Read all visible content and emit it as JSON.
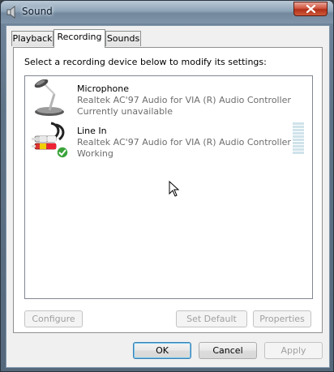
{
  "window": {
    "title": "Sound",
    "title_icon": "speaker-icon",
    "close_icon": "close-icon"
  },
  "tabs": [
    {
      "label": "Playback",
      "active": false
    },
    {
      "label": "Recording",
      "active": true
    },
    {
      "label": "Sounds",
      "active": false
    }
  ],
  "panel": {
    "instruction": "Select a recording device below to modify its settings:",
    "devices": [
      {
        "name": "Microphone",
        "description": "Realtek AC'97 Audio for VIA (R) Audio Controller",
        "status": "Currently unavailable",
        "icon": "microphone-icon"
      },
      {
        "name": "Line In",
        "description": "Realtek AC'97 Audio for VIA (R) Audio Controller",
        "status": "Working",
        "icon": "line-in-cable-icon",
        "badge_icon": "check-icon",
        "level_meter": "level-meter"
      }
    ],
    "buttons": {
      "configure": "Configure",
      "set_default": "Set Default",
      "properties": "Properties"
    }
  },
  "footer": {
    "ok": "OK",
    "cancel": "Cancel",
    "apply": "Apply"
  },
  "colors": {
    "frame": "#5f7387",
    "status_gray": "#6d6d6d",
    "default_button_border": "#3c7fb1",
    "check_badge": "#3aa33a"
  }
}
